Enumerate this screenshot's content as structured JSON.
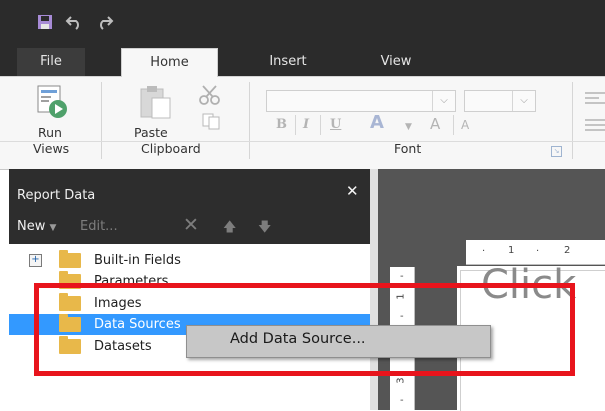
{
  "quick_access": {
    "save_icon": "save-icon",
    "undo_icon": "undo-icon",
    "redo_icon": "redo-icon"
  },
  "tabs": [
    {
      "label": "File"
    },
    {
      "label": "Home"
    },
    {
      "label": "Insert"
    },
    {
      "label": "View"
    }
  ],
  "ribbon": {
    "run_label": "Run",
    "paste_label": "Paste",
    "groups": {
      "views": "Views",
      "clipboard": "Clipboard",
      "font": "Font"
    },
    "format_buttons": {
      "bold": "B",
      "italic": "I",
      "underline": "U",
      "font_color": "A",
      "grow": "A",
      "shrink": "A"
    }
  },
  "report_data": {
    "title": "Report Data",
    "toolbar": {
      "new_label": "New",
      "edit_label": "Edit..."
    },
    "tree": [
      {
        "label": "Built-in Fields",
        "expandable": true
      },
      {
        "label": "Parameters",
        "expandable": false
      },
      {
        "label": "Images",
        "expandable": false
      },
      {
        "label": "Data Sources",
        "expandable": false,
        "selected": true
      },
      {
        "label": "Datasets",
        "expandable": false
      }
    ]
  },
  "design_surface": {
    "placeholder_text": "Click",
    "ruler_top": [
      "1",
      "2"
    ],
    "ruler_left": [
      "1",
      "3"
    ]
  },
  "context_menu": {
    "item": "Add Data Source..."
  },
  "colors": {
    "dark_bar": "#2b2b2b",
    "ribbon_bg": "#f7f7f7",
    "selection": "#3399ff",
    "highlight": "#e8141c",
    "folder": "#e8b84a"
  }
}
